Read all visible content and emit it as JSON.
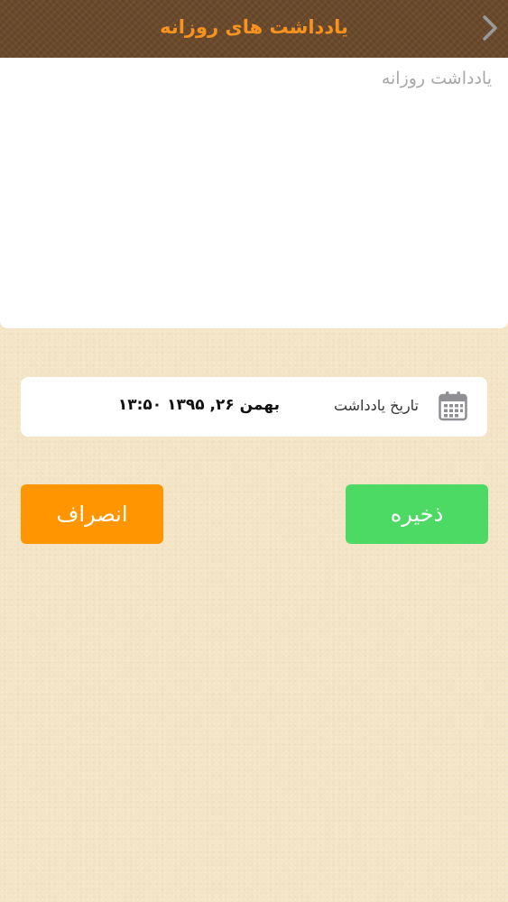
{
  "header": {
    "title": "یادداشت های روزانه",
    "back_icon": "chevron-right-icon",
    "title_color": "#f7931e",
    "background_color": "#6b4a2c"
  },
  "note": {
    "placeholder": "یادداشت روزانه",
    "value": ""
  },
  "date_card": {
    "icon": "calendar-icon",
    "label": "تاریخ یادداشت",
    "value": "بهمن ۲۶, ۱۳۹۵ ۱۳:۵۰"
  },
  "buttons": {
    "save_label": "ذخیره",
    "save_color": "#4cd964",
    "cancel_label": "انصراف",
    "cancel_color": "#ff9500"
  }
}
